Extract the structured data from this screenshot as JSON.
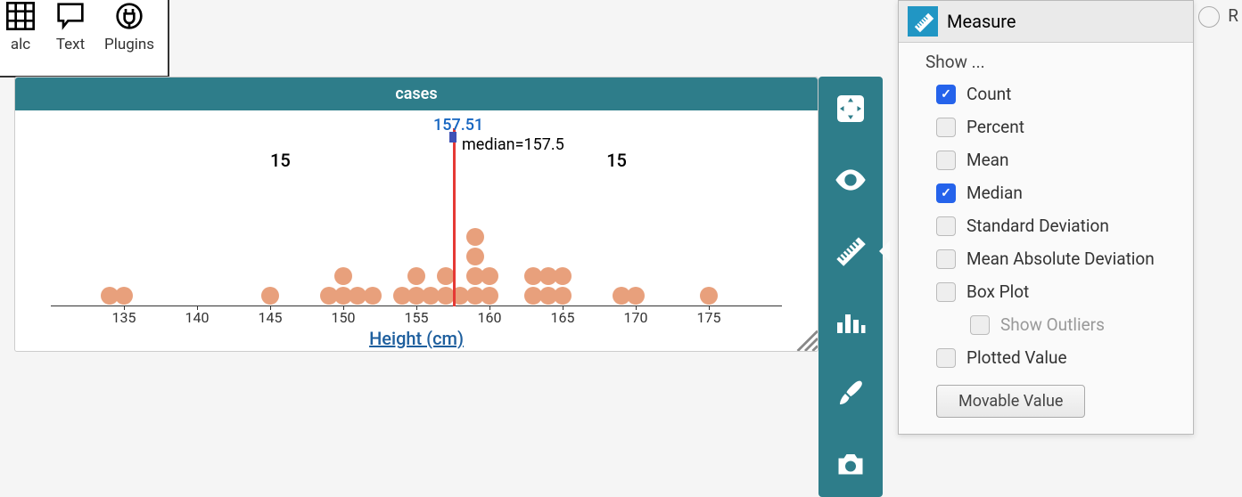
{
  "toolbar": {
    "items": [
      {
        "name": "calc",
        "label": "alc"
      },
      {
        "name": "text",
        "label": "Text"
      },
      {
        "name": "plugins",
        "label": "Plugins"
      }
    ]
  },
  "chart": {
    "title": "cases",
    "axis_label": "Height (cm)",
    "median_value_label": "157.51",
    "median_text": "median=157.5",
    "count_left": "15",
    "count_right": "15",
    "ticks": [
      "135",
      "140",
      "145",
      "150",
      "155",
      "160",
      "165",
      "170",
      "175"
    ]
  },
  "chart_data": {
    "type": "dot",
    "title": "cases",
    "xlabel": "Height (cm)",
    "xlim": [
      130,
      180
    ],
    "ylim": [
      0,
      5
    ],
    "median": 157.5,
    "median_movable_value": 157.51,
    "count_below_median": 15,
    "count_above_median": 15,
    "points": [
      134,
      135,
      145,
      149,
      150,
      150,
      151,
      152,
      154,
      155,
      155,
      156,
      157,
      157,
      158,
      159,
      159,
      159,
      159,
      160,
      160,
      163,
      163,
      164,
      164,
      165,
      165,
      169,
      170,
      175
    ]
  },
  "side_tools": [
    {
      "name": "rescale",
      "icon": "move"
    },
    {
      "name": "hide-show",
      "icon": "eye"
    },
    {
      "name": "measure",
      "icon": "ruler",
      "active": true
    },
    {
      "name": "plot-type",
      "icon": "bars"
    },
    {
      "name": "format",
      "icon": "brush"
    },
    {
      "name": "snapshot",
      "icon": "camera"
    }
  ],
  "measure_panel": {
    "title": "Measure",
    "show_label": "Show ...",
    "options": [
      {
        "key": "count",
        "label": "Count",
        "checked": true
      },
      {
        "key": "percent",
        "label": "Percent",
        "checked": false
      },
      {
        "key": "mean",
        "label": "Mean",
        "checked": false
      },
      {
        "key": "median",
        "label": "Median",
        "checked": true
      },
      {
        "key": "stddev",
        "label": "Standard Deviation",
        "checked": false
      },
      {
        "key": "mad",
        "label": "Mean Absolute Deviation",
        "checked": false
      },
      {
        "key": "boxplot",
        "label": "Box Plot",
        "checked": false
      },
      {
        "key": "outliers",
        "label": "Show Outliers",
        "checked": false,
        "indent": true
      },
      {
        "key": "plotted",
        "label": "Plotted Value",
        "checked": false
      }
    ],
    "movable_button": "Movable Value"
  },
  "corner_label": "R"
}
